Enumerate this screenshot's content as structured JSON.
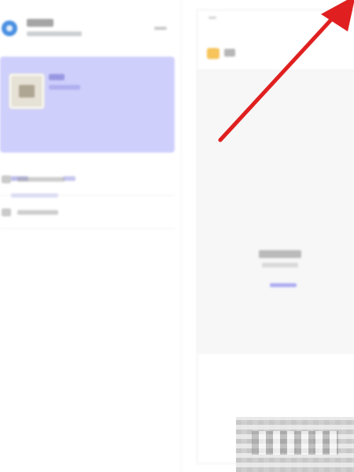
{
  "colors": {
    "accent": "#cfcffc",
    "avatar_blue": "#4a90e2",
    "folder_yellow": "#f6c45a",
    "link_blue": "#7b7bef",
    "annotation_red": "#e02020",
    "content_bg": "#f7f7f8"
  },
  "left_panel": {
    "header": {
      "avatar_icon": "app-avatar-icon",
      "action_icon": "more-icon"
    },
    "profile_card": {
      "image_icon": "photo-thumbnail-icon"
    },
    "menu": [
      {
        "icon": "list-icon"
      },
      {
        "icon": "settings-icon"
      }
    ]
  },
  "right_panel": {
    "header": {
      "icon": "folder-icon"
    },
    "empty_state": {
      "link_style": "accent-link"
    }
  },
  "annotation": {
    "type": "arrow",
    "icon": "red-arrow-icon",
    "points_to": "top-right"
  }
}
